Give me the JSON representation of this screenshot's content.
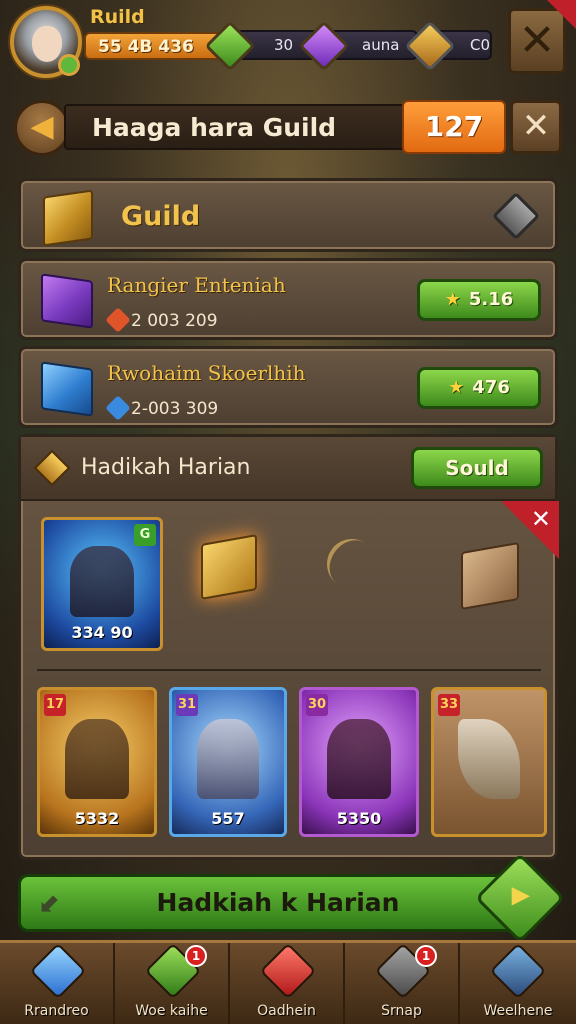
{
  "player": {
    "name": "Ruild",
    "gold": "55 4B 436"
  },
  "resources": [
    {
      "icon": "green-gem-icon",
      "value": "30"
    },
    {
      "icon": "purple-gem-icon",
      "value": "auna"
    },
    {
      "icon": "gold-gem-icon",
      "value": "C0"
    }
  ],
  "header": {
    "back_icon": "arrow-left-icon",
    "title": "Haaga hara Guild",
    "count": "127",
    "close_icon": "close-icon"
  },
  "guild": {
    "label": "Guild",
    "icon": "gold-cube-icon"
  },
  "items": [
    {
      "name": "Rangier Enteniah",
      "sub": "2 003 209",
      "price": "5.16",
      "icon": "purple-cube-icon"
    },
    {
      "name": "Rwohaim Skoerlhih",
      "sub": "2-003 309",
      "price": "476",
      "icon": "blue-cube-icon"
    }
  ],
  "daily": {
    "title": "Hadikah Harian",
    "button": "Sould",
    "featured_card": {
      "level": "G",
      "value": "334 90"
    },
    "cards": [
      {
        "level": "17",
        "value": "5332",
        "color": "#e0a53a"
      },
      {
        "level": "31",
        "value": "557",
        "color": "#5aa8e8"
      },
      {
        "level": "30",
        "value": "5350",
        "color": "#b45ad0"
      },
      {
        "level": "33",
        "value": "",
        "color": "#b48650"
      }
    ]
  },
  "big_button": "Hadkiah k Harian",
  "nav": [
    {
      "label": "Rrandreo",
      "icon": "blue-crystal-icon",
      "badge": ""
    },
    {
      "label": "Woe kaihe",
      "icon": "green-cube-icon",
      "badge": "1"
    },
    {
      "label": "Oadhein",
      "icon": "red-cube-icon",
      "badge": ""
    },
    {
      "label": "Srnap",
      "icon": "shop-bag-icon",
      "badge": "1"
    },
    {
      "label": "Weelhene",
      "icon": "sword-icon",
      "badge": ""
    }
  ]
}
